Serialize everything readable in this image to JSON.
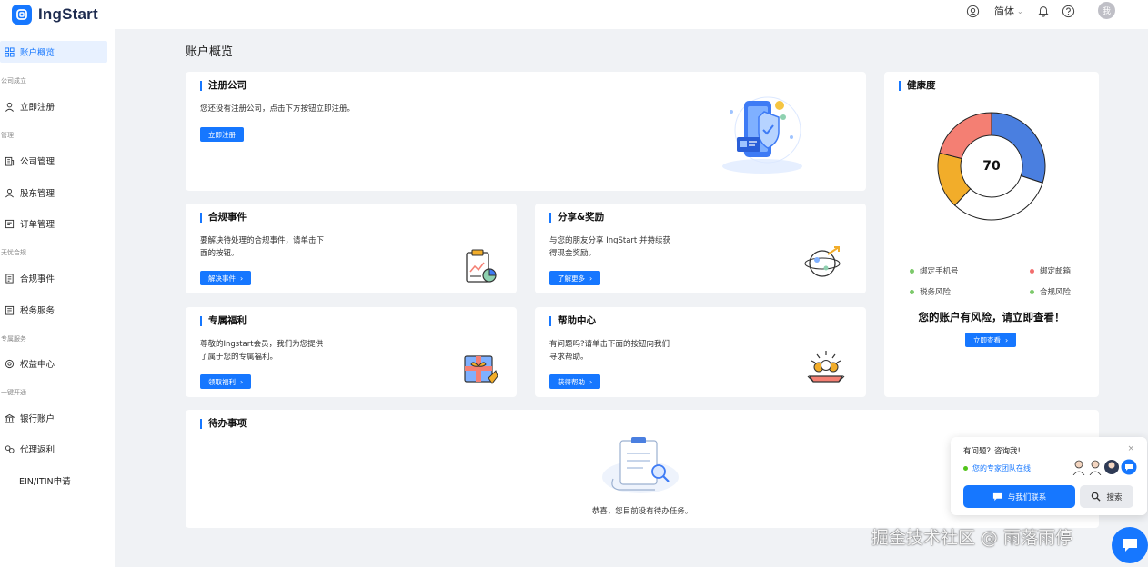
{
  "brand": {
    "name": "IngStart"
  },
  "topbar": {
    "language": "简体",
    "avatar_text": "我"
  },
  "sidebar": {
    "items": [
      {
        "label": "账户概览"
      },
      {
        "label": "立即注册"
      },
      {
        "label": "公司管理"
      },
      {
        "label": "股东管理"
      },
      {
        "label": "订单管理"
      },
      {
        "label": "合规事件"
      },
      {
        "label": "税务服务"
      },
      {
        "label": "权益中心"
      },
      {
        "label": "银行账户"
      },
      {
        "label": "代理返利"
      },
      {
        "label": "EIN/ITIN申请"
      }
    ],
    "groups": [
      "公司成立",
      "管理",
      "无忧合规",
      "专属服务",
      "一键开通"
    ]
  },
  "main": {
    "page_title": "账户概览",
    "register": {
      "title": "注册公司",
      "desc": "您还没有注册公司，点击下方按钮立即注册。",
      "button": "立即注册"
    },
    "compliance": {
      "title": "合规事件",
      "desc_line1": "要解决待处理的合规事件，请单击下",
      "desc_line2": "面的按钮。",
      "button": "解决事件"
    },
    "share": {
      "title": "分享&奖励",
      "desc_line1": "与您的朋友分享 IngStart 并持续获",
      "desc_line2": "得现金奖励。",
      "button": "了解更多"
    },
    "benefits": {
      "title": "专属福利",
      "desc_line1": "尊敬的Ingstart会员，我们为您提供",
      "desc_line2": "了属于您的专属福利。",
      "button": "领取福利"
    },
    "help": {
      "title": "帮助中心",
      "desc_line1": "有问题吗?请单击下面的按钮向我们",
      "desc_line2": "寻求帮助。",
      "button": "获得帮助"
    },
    "todo": {
      "title": "待办事项",
      "empty_text": "恭喜，您目前没有待办任务。"
    }
  },
  "health": {
    "title": "健康度",
    "score": "70",
    "legend": [
      {
        "label": "绑定手机号",
        "color": "#7cc96a"
      },
      {
        "label": "绑定邮箱",
        "color": "#f26d6d"
      },
      {
        "label": "税务风险",
        "color": "#7cc96a"
      },
      {
        "label": "合规风险",
        "color": "#7cc96a"
      }
    ],
    "risk_text": "您的账户有风险，请立即查看！",
    "button": "立即查看",
    "segments": [
      {
        "color": "#4a7fe0",
        "fraction": 0.3
      },
      {
        "color": "#ffffff",
        "fraction": 0.32
      },
      {
        "color": "#f2ad2a",
        "fraction": 0.17
      },
      {
        "color": "#f47f73",
        "fraction": 0.21
      }
    ]
  },
  "chat": {
    "title": "有问题？咨询我!",
    "close": "×",
    "online": "您的专家团队在线",
    "contact_button": "与我们联系",
    "search_button": "搜索"
  },
  "watermark": "掘金技术社区 @ 雨落雨停",
  "colors": {
    "primary": "#1677ff",
    "background": "#f0f2f5"
  }
}
